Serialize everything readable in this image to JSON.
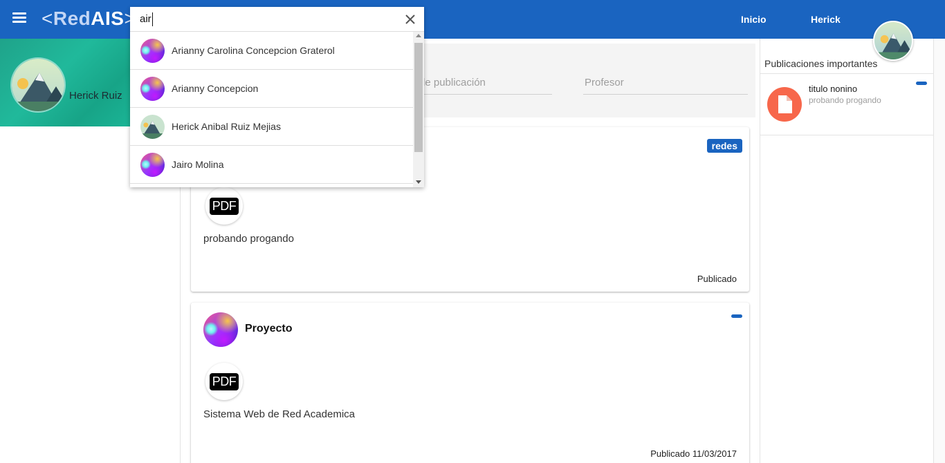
{
  "app": {
    "brand_open": "<",
    "brand_red": "Red",
    "brand_ais": "AIS",
    "brand_close": ">",
    "accent_color": "#1a64c0"
  },
  "nav": {
    "home_label": "Inicio",
    "user_label": "Herick"
  },
  "search": {
    "value": "air",
    "results": [
      {
        "name": "Arianny Carolina Concepcion Graterol",
        "avatar": "purple-abstract"
      },
      {
        "name": "Arianny Concepcion",
        "avatar": "purple-abstract"
      },
      {
        "name": "Herick Anibal Ruiz Mejias",
        "avatar": "mountain-landscape"
      },
      {
        "name": "Jairo Molina",
        "avatar": "purple-abstract"
      }
    ]
  },
  "profile": {
    "name": "Herick Ruiz"
  },
  "filters": {
    "date_label": "de publicación",
    "professor_label": "Profesor"
  },
  "posts": [
    {
      "tag": "redes",
      "attachment_label": "PDF",
      "description": "probando progando",
      "status": "Publicado"
    },
    {
      "title": "Proyecto",
      "attachment_label": "PDF",
      "description": "Sistema Web de Red Academica",
      "status": "Publicado 11/03/2017"
    }
  ],
  "important": {
    "title": "Publicaciones importantes",
    "items": [
      {
        "title": "titulo nonino",
        "subtitle": "probando progando",
        "icon": "document-icon",
        "icon_color": "#f7674b"
      }
    ]
  }
}
